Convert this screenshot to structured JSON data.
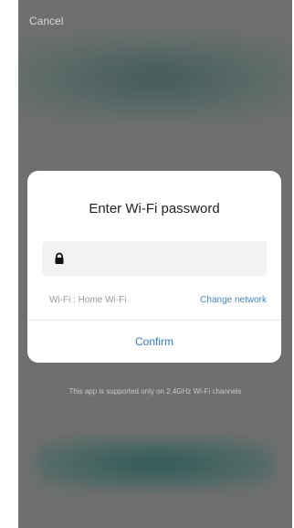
{
  "header": {
    "cancel_label": "Cancel"
  },
  "dialog": {
    "title": "Enter Wi-Fi password",
    "password_value": "",
    "wifi_label": "Wi-Fi : Home Wi-Fi",
    "change_network_label": "Change network",
    "confirm_label": "Confirm"
  },
  "footnote": "This app is supported only on 2.4GHz Wi-Fi channels",
  "icons": {
    "lock": "lock-icon"
  },
  "colors": {
    "accent": "#2e78c9",
    "overlay": "#6f6f6f"
  }
}
